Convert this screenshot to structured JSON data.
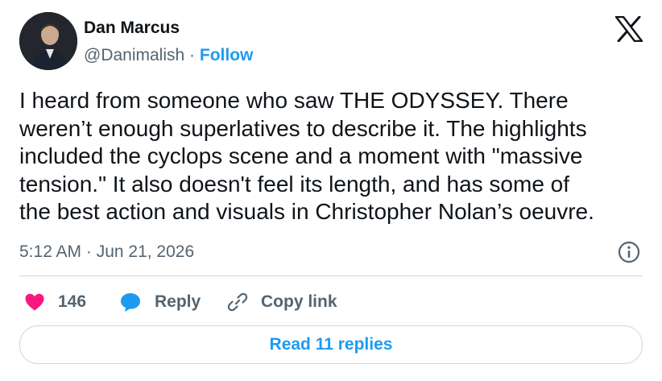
{
  "author": {
    "name": "Dan Marcus",
    "handle": "@Danimalish",
    "separator": " · ",
    "follow_label": "Follow"
  },
  "tweet": {
    "lines": [
      "I heard from someone who saw THE ODYSSEY. There",
      "weren’t enough superlatives to describe it. The highlights",
      "included the cyclops scene and a moment with \"massive",
      "tension.\" It also doesn't feel its length, and has some of",
      "the best action and visuals in Christopher Nolan’s oeuvre."
    ],
    "timestamp": "5:12 AM · Jun 21, 2026"
  },
  "actions": {
    "like_count": "146",
    "reply_label": "Reply",
    "copy_label": "Copy link"
  },
  "footer": {
    "read_replies_label": "Read 11 replies"
  },
  "colors": {
    "accent": "#1d9bf0",
    "heart": "#f91880",
    "secondary_text": "#536471",
    "primary_text": "#0f1419",
    "border": "#cfd9de"
  },
  "icons": [
    "x-logo-icon",
    "info-icon",
    "heart-icon",
    "reply-bubble-icon",
    "link-icon"
  ]
}
